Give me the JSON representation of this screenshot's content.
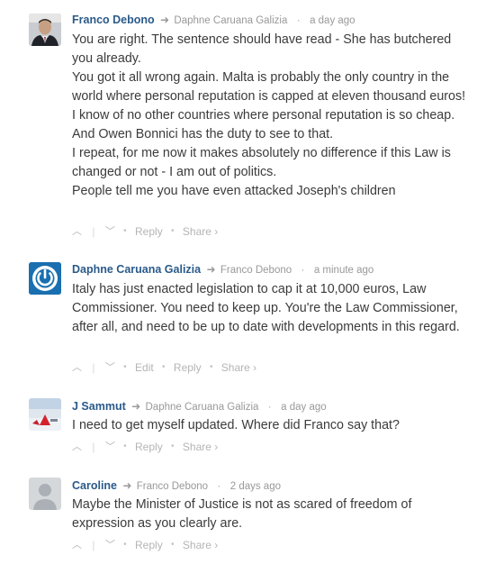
{
  "comments": [
    {
      "author": "Franco Debono",
      "reply_to": "Daphne Caruana Galizia",
      "time": "a day ago",
      "paragraphs": [
        "You are right. The sentence should have read - She has butchered you already.",
        "You got it all wrong again. Malta is probably the only country in the world where personal reputation is capped at eleven thousand euros! I know of no other countries where personal reputation is so cheap. And Owen Bonnici has the duty to see to that.",
        "I repeat, for me now it makes absolutely no difference if this Law is changed or not - I am out of politics.",
        "People tell me you have even attacked Joseph's children"
      ],
      "actions": {
        "reply": "Reply",
        "share": "Share ›"
      }
    },
    {
      "author": "Daphne Caruana Galizia",
      "reply_to": "Franco Debono",
      "time": "a minute ago",
      "paragraphs": [
        "Italy has just enacted legislation to cap it at 10,000 euros, Law Commissioner. You need to keep up. You're the Law Commissioner, after all, and need to be up to date with developments in this regard."
      ],
      "actions": {
        "edit": "Edit",
        "reply": "Reply",
        "share": "Share ›"
      }
    },
    {
      "author": "J Sammut",
      "reply_to": "Daphne Caruana Galizia",
      "time": "a day ago",
      "paragraphs": [
        "I need to get myself updated. Where did Franco say that?"
      ],
      "actions": {
        "reply": "Reply",
        "share": "Share ›"
      }
    },
    {
      "author": "Caroline",
      "reply_to": "Franco Debono",
      "time": "2 days ago",
      "paragraphs": [
        "Maybe the Minister of Justice is not as scared of freedom of expression as you clearly are."
      ],
      "actions": {
        "reply": "Reply",
        "share": "Share ›"
      }
    }
  ],
  "icons": {
    "reply_arrow": "reply-arrow-icon",
    "upvote": "upvote-icon",
    "downvote": "downvote-icon"
  },
  "colors": {
    "author": "#2a5a8a",
    "text": "#3b3b3b",
    "meta": "#999999",
    "avatar_blue": "#1a6fb0"
  }
}
